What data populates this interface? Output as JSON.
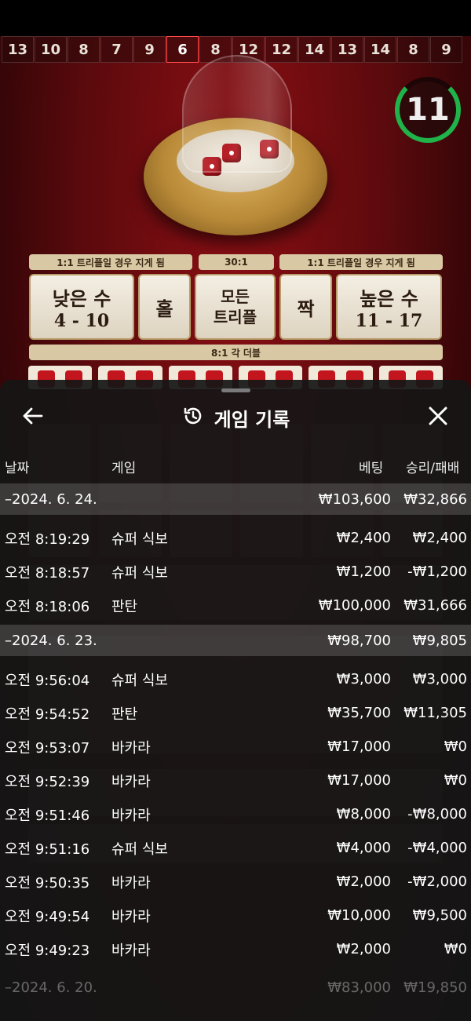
{
  "game_table": {
    "results_history": [
      "13",
      "10",
      "8",
      "7",
      "9",
      "6",
      "8",
      "12",
      "12",
      "14",
      "13",
      "14",
      "8",
      "9"
    ],
    "highlighted_index": 5,
    "timer": "11",
    "odds_labels": {
      "left": "1:1 트리플일 경우 지게 됨",
      "center": "30:1",
      "right": "1:1 트리플일 경우 지게 됨",
      "double": "8:1 각 더블"
    },
    "bets": {
      "small_label": "낮은 수",
      "small_range": "4 - 10",
      "odd_label": "홀",
      "any_triple_label_1": "모든",
      "any_triple_label_2": "트리플",
      "even_label": "짝",
      "big_label": "높은 수",
      "big_range": "11 - 17"
    }
  },
  "sheet": {
    "title": "게임 기록",
    "icons": {
      "back": "arrow-left-icon",
      "history": "history-clock-icon",
      "close": "close-icon"
    },
    "columns": {
      "date": "날짜",
      "game": "게임",
      "bet": "베팅",
      "win_loss": "승리/패배"
    },
    "rows": [
      {
        "type": "date",
        "time": "–2024. 6. 24.",
        "game": "",
        "bet": "₩103,600",
        "win": "₩32,866"
      },
      {
        "type": "entry",
        "time": "오전 8:19:29",
        "game": "슈퍼 식보",
        "bet": "₩2,400",
        "win": "₩2,400"
      },
      {
        "type": "entry",
        "time": "오전 8:18:57",
        "game": "슈퍼 식보",
        "bet": "₩1,200",
        "win": "-₩1,200"
      },
      {
        "type": "entry",
        "time": "오전 8:18:06",
        "game": "판탄",
        "bet": "₩100,000",
        "win": "₩31,666"
      },
      {
        "type": "date",
        "time": "–2024. 6. 23.",
        "game": "",
        "bet": "₩98,700",
        "win": "₩9,805"
      },
      {
        "type": "entry",
        "time": "오전 9:56:04",
        "game": "슈퍼 식보",
        "bet": "₩3,000",
        "win": "₩3,000"
      },
      {
        "type": "entry",
        "time": "오전 9:54:52",
        "game": "판탄",
        "bet": "₩35,700",
        "win": "₩11,305"
      },
      {
        "type": "entry",
        "time": "오전 9:53:07",
        "game": "바카라",
        "bet": "₩17,000",
        "win": "₩0"
      },
      {
        "type": "entry",
        "time": "오전 9:52:39",
        "game": "바카라",
        "bet": "₩17,000",
        "win": "₩0"
      },
      {
        "type": "entry",
        "time": "오전 9:51:46",
        "game": "바카라",
        "bet": "₩8,000",
        "win": "-₩8,000"
      },
      {
        "type": "entry",
        "time": "오전 9:51:16",
        "game": "슈퍼 식보",
        "bet": "₩4,000",
        "win": "-₩4,000"
      },
      {
        "type": "entry",
        "time": "오전 9:50:35",
        "game": "바카라",
        "bet": "₩2,000",
        "win": "-₩2,000"
      },
      {
        "type": "entry",
        "time": "오전 9:49:54",
        "game": "바카라",
        "bet": "₩10,000",
        "win": "₩9,500"
      },
      {
        "type": "entry",
        "time": "오전 9:49:23",
        "game": "바카라",
        "bet": "₩2,000",
        "win": "₩0"
      },
      {
        "type": "date-faded",
        "time": "–2024. 6. 20.",
        "game": "",
        "bet": "₩83,000",
        "win": "₩19,850"
      }
    ]
  },
  "colors": {
    "accent_green": "#1fb34a",
    "table_red": "#7a0c10",
    "sheet_bg": "#161616"
  }
}
